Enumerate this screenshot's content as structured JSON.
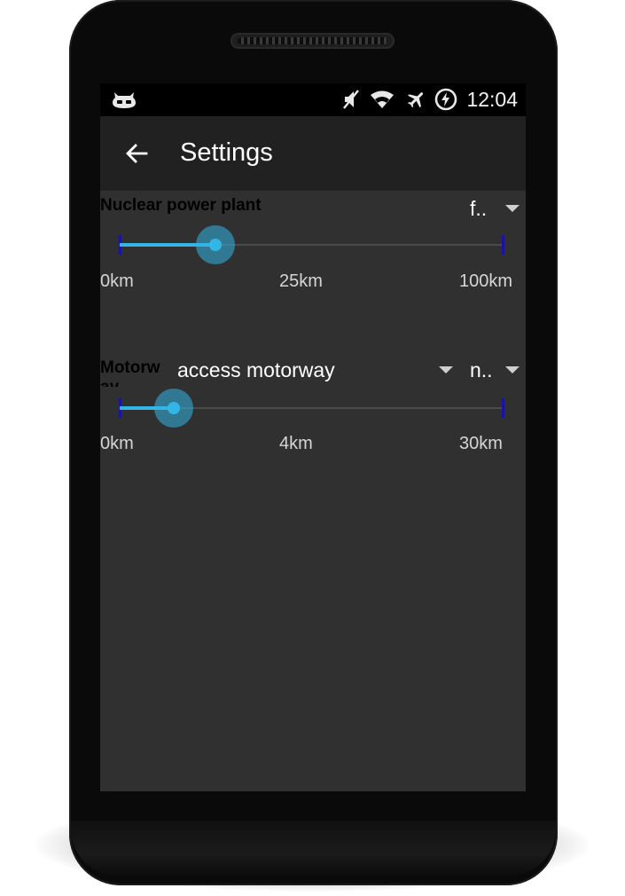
{
  "status_bar": {
    "icons": [
      "cyanogenmod-icon",
      "mute-icon",
      "wifi-icon",
      "airplane-mode-icon",
      "battery-charging-icon"
    ],
    "time": "12:04"
  },
  "app_bar": {
    "back_icon": "arrow-left-icon",
    "title": "Settings"
  },
  "settings": [
    {
      "label": "Nuclear power plant",
      "spinner_value": "f..",
      "slider": {
        "min_label": "0km",
        "mid_label": "25km",
        "max_label": "100km",
        "value_fraction": 0.25
      }
    },
    {
      "label": "Motorw",
      "label_overflow": "ay",
      "type_spinner_value": "access motorway",
      "spinner_value": "n..",
      "slider": {
        "min_label": "0km",
        "mid_label": "4km",
        "max_label": "30km",
        "value_fraction": 0.14
      }
    }
  ],
  "colors": {
    "accent": "#33b5e5",
    "background": "#303030",
    "app_bar": "#212121",
    "tick": "#1414a8"
  }
}
